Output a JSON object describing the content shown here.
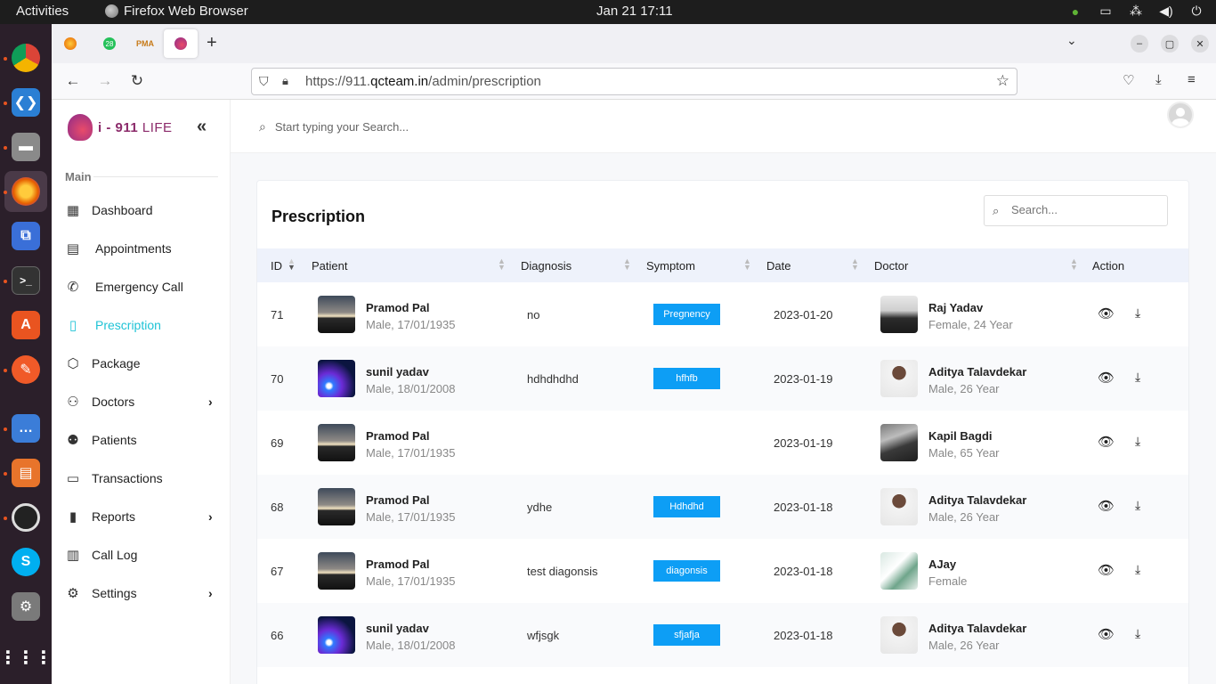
{
  "topbar": {
    "activities": "Activities",
    "app": "Firefox Web Browser",
    "clock": "Jan 21  17:11"
  },
  "browser": {
    "tab_badge": "28",
    "tab_pma": "PMA",
    "url_prefix": "https://911.",
    "url_domain": "qcteam.in",
    "url_path": "/admin/prescription"
  },
  "app": {
    "logo_prefix": "i - 911",
    "logo_suffix": " LIFE",
    "search_placeholder": "Start typing your Search..."
  },
  "sidebar": {
    "section_label": "Main",
    "items": [
      {
        "label": "Dashboard",
        "icon": "grid-icon",
        "has_chevron": false,
        "active": false
      },
      {
        "label": "Appointments",
        "icon": "calendar-icon",
        "has_chevron": false,
        "active": false
      },
      {
        "label": "Emergency Call",
        "icon": "phone-icon",
        "has_chevron": false,
        "active": false
      },
      {
        "label": "Prescription",
        "icon": "clipboard-icon",
        "has_chevron": false,
        "active": true
      },
      {
        "label": "Package",
        "icon": "package-icon",
        "has_chevron": false,
        "active": false
      },
      {
        "label": "Doctors",
        "icon": "user-plus-icon",
        "has_chevron": true,
        "active": false
      },
      {
        "label": "Patients",
        "icon": "users-icon",
        "has_chevron": false,
        "active": false
      },
      {
        "label": "Transactions",
        "icon": "credit-card-icon",
        "has_chevron": false,
        "active": false
      },
      {
        "label": "Reports",
        "icon": "bar-chart-icon",
        "has_chevron": true,
        "active": false
      },
      {
        "label": "Call Log",
        "icon": "book-icon",
        "has_chevron": false,
        "active": false
      },
      {
        "label": "Settings",
        "icon": "gear-icon",
        "has_chevron": true,
        "active": false
      }
    ]
  },
  "page": {
    "title": "Prescription",
    "search_placeholder": "Search..."
  },
  "table": {
    "columns": [
      "ID",
      "Patient",
      "Diagnosis",
      "Symptom",
      "Date",
      "Doctor",
      "Action"
    ],
    "rows": [
      {
        "id": "71",
        "patient_name": "Pramod Pal",
        "patient_info": "Male, 17/01/1935",
        "diagnosis": "no",
        "symptom": "Pregnency",
        "date": "2023-01-20",
        "doctor_name": "Raj Yadav",
        "doctor_info": "Female, 24 Year"
      },
      {
        "id": "70",
        "patient_name": "sunil yadav",
        "patient_info": "Male, 18/01/2008",
        "diagnosis": "hdhdhdhd",
        "symptom": "hfhfb",
        "date": "2023-01-19",
        "doctor_name": "Aditya Talavdekar",
        "doctor_info": "Male, 26 Year"
      },
      {
        "id": "69",
        "patient_name": "Pramod Pal",
        "patient_info": "Male, 17/01/1935",
        "diagnosis": "",
        "symptom": "",
        "date": "2023-01-19",
        "doctor_name": "Kapil Bagdi",
        "doctor_info": "Male, 65 Year"
      },
      {
        "id": "68",
        "patient_name": "Pramod Pal",
        "patient_info": "Male, 17/01/1935",
        "diagnosis": "ydhe",
        "symptom": "Hdhdhd",
        "date": "2023-01-18",
        "doctor_name": "Aditya Talavdekar",
        "doctor_info": "Male, 26 Year"
      },
      {
        "id": "67",
        "patient_name": "Pramod Pal",
        "patient_info": "Male, 17/01/1935",
        "diagnosis": "test diagonsis",
        "symptom": "diagonsis",
        "date": "2023-01-18",
        "doctor_name": "AJay",
        "doctor_info": "Female"
      },
      {
        "id": "66",
        "patient_name": "sunil yadav",
        "patient_info": "Male, 18/01/2008",
        "diagnosis": "wfjsgk",
        "symptom": "sfjafja",
        "date": "2023-01-18",
        "doctor_name": "Aditya Talavdekar",
        "doctor_info": "Male, 26 Year"
      }
    ]
  },
  "colors": {
    "accent": "#1fc3d6",
    "badge": "#0d9ef5",
    "header_bg": "#eef2fb"
  }
}
